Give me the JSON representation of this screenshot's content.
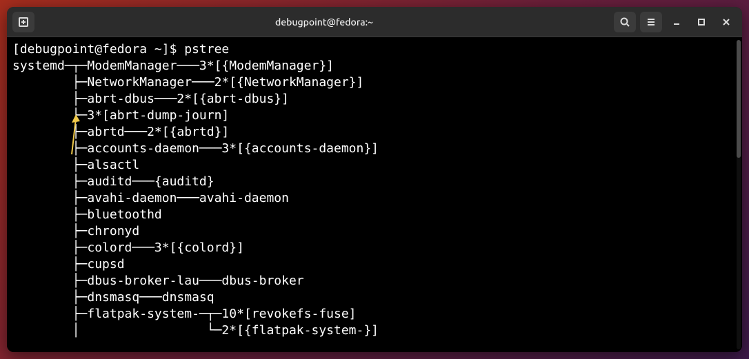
{
  "window": {
    "title": "debugpoint@fedora:~"
  },
  "titlebar": {
    "new_tab_icon": "new-tab-icon",
    "search_icon": "search-icon",
    "menu_icon": "hamburger-icon",
    "minimize_icon": "minimize-icon",
    "maximize_icon": "maximize-icon",
    "close_icon": "close-icon"
  },
  "terminal": {
    "prompt": "[debugpoint@fedora ~]$ ",
    "command": "pstree",
    "lines": [
      "systemd─┬─ModemManager───3*[{ModemManager}]",
      "        ├─NetworkManager───2*[{NetworkManager}]",
      "        ├─abrt-dbus───2*[{abrt-dbus}]",
      "        ├─3*[abrt-dump-journ]",
      "        ├─abrtd───2*[{abrtd}]",
      "        ├─accounts-daemon───3*[{accounts-daemon}]",
      "        ├─alsactl",
      "        ├─auditd───{auditd}",
      "        ├─avahi-daemon───avahi-daemon",
      "        ├─bluetoothd",
      "        ├─chronyd",
      "        ├─colord───3*[{colord}]",
      "        ├─cupsd",
      "        ├─dbus-broker-lau───dbus-broker",
      "        ├─dnsmasq───dnsmasq",
      "        ├─flatpak-system-─┬─10*[revokefs-fuse]",
      "        │                 └─2*[{flatpak-system-}]"
    ]
  },
  "annotation": {
    "arrow_color": "#f0c94a"
  }
}
